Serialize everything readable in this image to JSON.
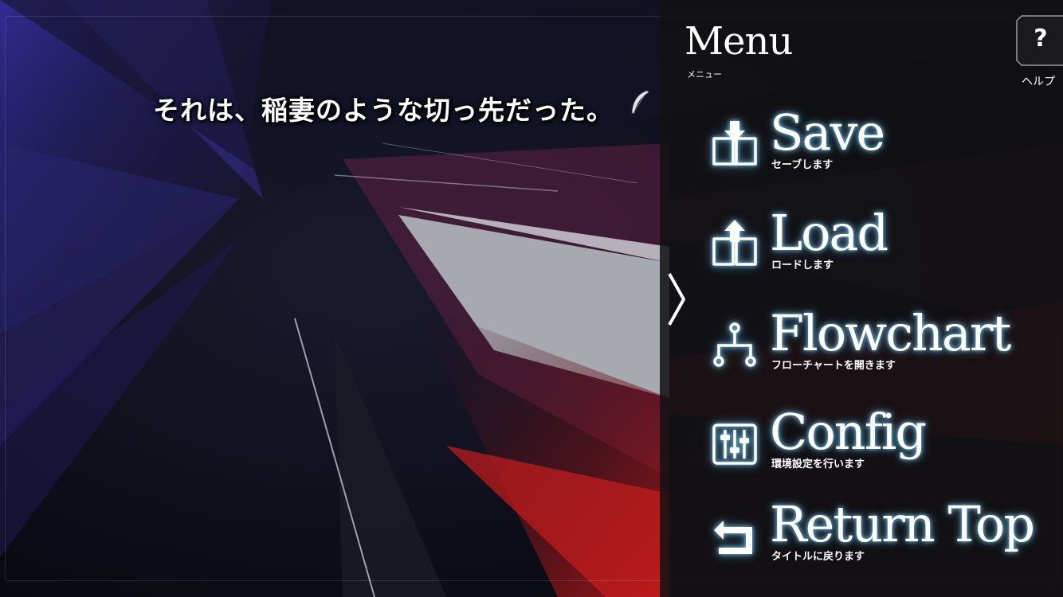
{
  "dialogue": {
    "text": "それは、稲妻のような切っ先だった。"
  },
  "menu": {
    "title": "Menu",
    "subtitle": "メニュー",
    "help": {
      "symbol": "?",
      "label": "ヘルプ"
    },
    "items": [
      {
        "label": "Save",
        "sub": "セーブします",
        "icon": "book-save-icon"
      },
      {
        "label": "Load",
        "sub": "ロードします",
        "icon": "book-load-icon"
      },
      {
        "label": "Flowchart",
        "sub": "フローチャートを開きます",
        "icon": "flowchart-icon"
      },
      {
        "label": "Config",
        "sub": "環境設定を行います",
        "icon": "sliders-icon"
      },
      {
        "label": "Return Top",
        "sub": "タイトルに戻ります",
        "icon": "return-arrow-icon"
      }
    ]
  },
  "colors": {
    "glow": "#8cdcff",
    "panel": "#121214",
    "text": "#ffffff"
  }
}
